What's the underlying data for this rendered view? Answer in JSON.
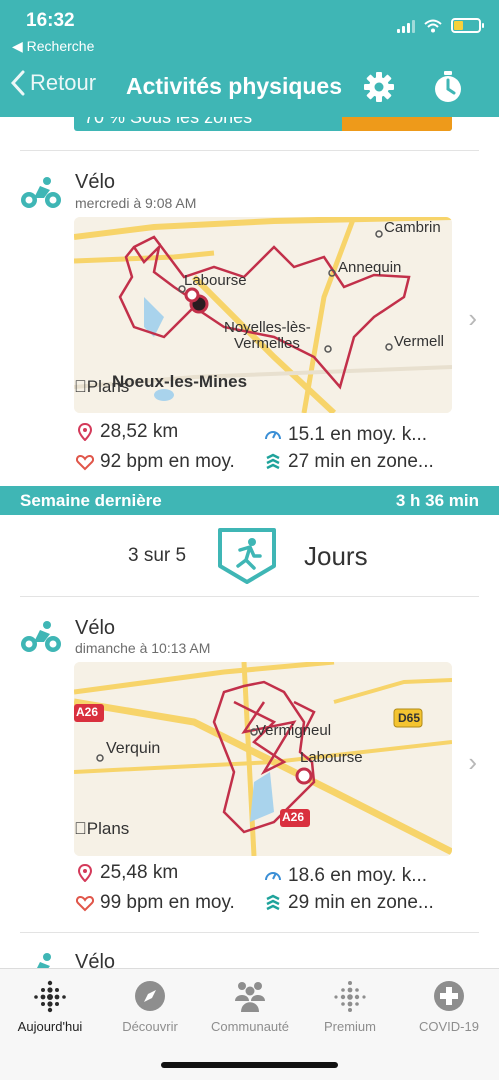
{
  "status": {
    "time": "16:32",
    "back_label": "◀ Recherche"
  },
  "nav": {
    "back_label": "Retour",
    "title": "Activités physiques",
    "settings_icon": "gear-icon",
    "timer_icon": "stopwatch-icon"
  },
  "partial_zone_text": "70 % Sous les zones",
  "colors": {
    "teal": "#3fb6b5",
    "orange": "#ee9a1a",
    "route": "#c2304a"
  },
  "activities": [
    {
      "type": "Vélo",
      "date": "mercredi à 9:08 AM",
      "map_labels": [
        "Cambrin",
        "Labourse",
        "Annequin",
        "Noyelles-lès-",
        "Vermelles",
        "Vermell",
        "Noeux-les-Mines",
        "Plans"
      ],
      "distance": "28,52 km",
      "speed": "15.1 en moy. k...",
      "heart": "92 bpm en moy.",
      "zones": "27 min en zone..."
    },
    {
      "type": "Vélo",
      "date": "dimanche à 10:13 AM",
      "map_labels": [
        "A26",
        "D65",
        "Verquin",
        "Vermigneul",
        "Labourse",
        "A26",
        "Plans"
      ],
      "distance": "25,48 km",
      "speed": "18.6 en moy. k...",
      "heart": "99 bpm en moy.",
      "zones": "29 min en zone..."
    },
    {
      "type": "Vélo"
    }
  ],
  "week": {
    "label": "Semaine dernière",
    "total": "3 h 36 min"
  },
  "goal": {
    "count": "3 sur 5",
    "unit": "Jours"
  },
  "tabs": [
    {
      "label": "Aujourd'hui",
      "icon": "fitbit-dots-icon"
    },
    {
      "label": "Découvrir",
      "icon": "compass-icon"
    },
    {
      "label": "Communauté",
      "icon": "community-icon"
    },
    {
      "label": "Premium",
      "icon": "premium-dots-icon"
    },
    {
      "label": "COVID-19",
      "icon": "plus-circle-icon"
    }
  ]
}
